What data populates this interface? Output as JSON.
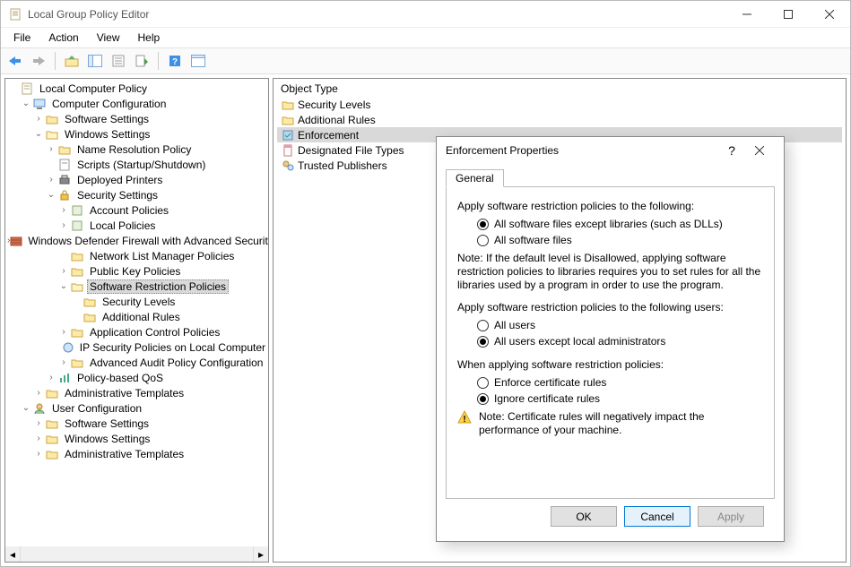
{
  "window": {
    "title": "Local Group Policy Editor"
  },
  "menubar": [
    "File",
    "Action",
    "View",
    "Help"
  ],
  "tree": {
    "root": "Local Computer Policy",
    "cc": "Computer Configuration",
    "cc_ss": "Software Settings",
    "cc_ws": "Windows Settings",
    "nrp": "Name Resolution Policy",
    "scripts": "Scripts (Startup/Shutdown)",
    "printers": "Deployed Printers",
    "sec": "Security Settings",
    "acct": "Account Policies",
    "local": "Local Policies",
    "wdf": "Windows Defender Firewall with Advanced Security",
    "nlm": "Network List Manager Policies",
    "pk": "Public Key Policies",
    "srp": "Software Restriction Policies",
    "srp_sl": "Security Levels",
    "srp_ar": "Additional Rules",
    "acp": "Application Control Policies",
    "ipsec": "IP Security Policies on Local Computer",
    "aapc": "Advanced Audit Policy Configuration",
    "qos": "Policy-based QoS",
    "cc_at": "Administrative Templates",
    "uc": "User Configuration",
    "uc_ss": "Software Settings",
    "uc_ws": "Windows Settings",
    "uc_at": "Administrative Templates"
  },
  "list": {
    "header": "Object Type",
    "items": [
      "Security Levels",
      "Additional Rules",
      "Enforcement",
      "Designated File Types",
      "Trusted Publishers"
    ],
    "selected": 2
  },
  "dialog": {
    "title": "Enforcement Properties",
    "help": "?",
    "tab": "General",
    "s1_label": "Apply software restriction policies to the following:",
    "s1_opt1": "All software files except libraries (such as DLLs)",
    "s1_opt2": "All software files",
    "s1_note": "Note:  If the default level is Disallowed, applying software restriction policies to libraries requires you to set rules for all the libraries used by a program in order to use the program.",
    "s2_label": "Apply software restriction policies to the following users:",
    "s2_opt1": "All users",
    "s2_opt2": "All users except local administrators",
    "s3_label": "When applying software restriction policies:",
    "s3_opt1": "Enforce certificate rules",
    "s3_opt2": "Ignore certificate rules",
    "warn": "Note:  Certificate rules will negatively impact the performance of your machine.",
    "ok": "OK",
    "cancel": "Cancel",
    "apply": "Apply"
  }
}
